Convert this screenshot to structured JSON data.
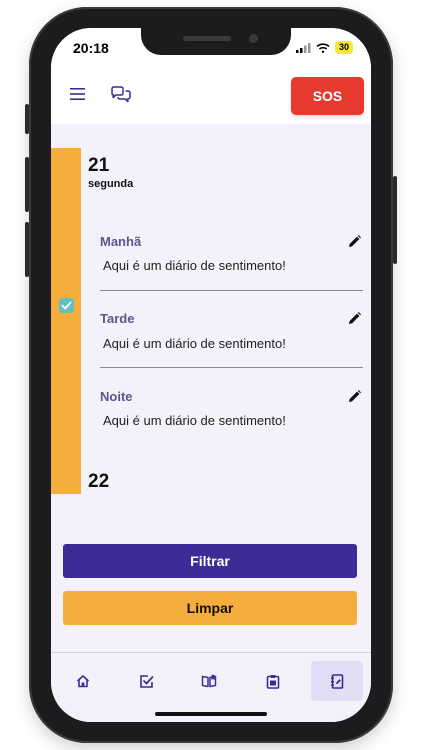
{
  "status_bar": {
    "time": "20:18",
    "battery": "30"
  },
  "header": {
    "sos_label": "SOS"
  },
  "days": [
    {
      "number": "21",
      "weekday": "segunda"
    },
    {
      "number": "22"
    }
  ],
  "entries": [
    {
      "period": "Manhã",
      "text": "Aqui é um diário de sentimento!"
    },
    {
      "period": "Tarde",
      "text": "Aqui é um diário de sentimento!"
    },
    {
      "period": "Noite",
      "text": "Aqui é um diário de sentimento!"
    }
  ],
  "actions": {
    "filter_label": "Filtrar",
    "clear_label": "Limpar"
  },
  "nav": {
    "items": [
      "home-icon",
      "checklist-icon",
      "book-icon",
      "clipboard-icon",
      "journal-icon"
    ],
    "active_index": 4
  },
  "colors": {
    "primary": "#3f2b96",
    "accent": "#f5ad3b",
    "sos": "#e53a2d",
    "check": "#62bfbf"
  }
}
